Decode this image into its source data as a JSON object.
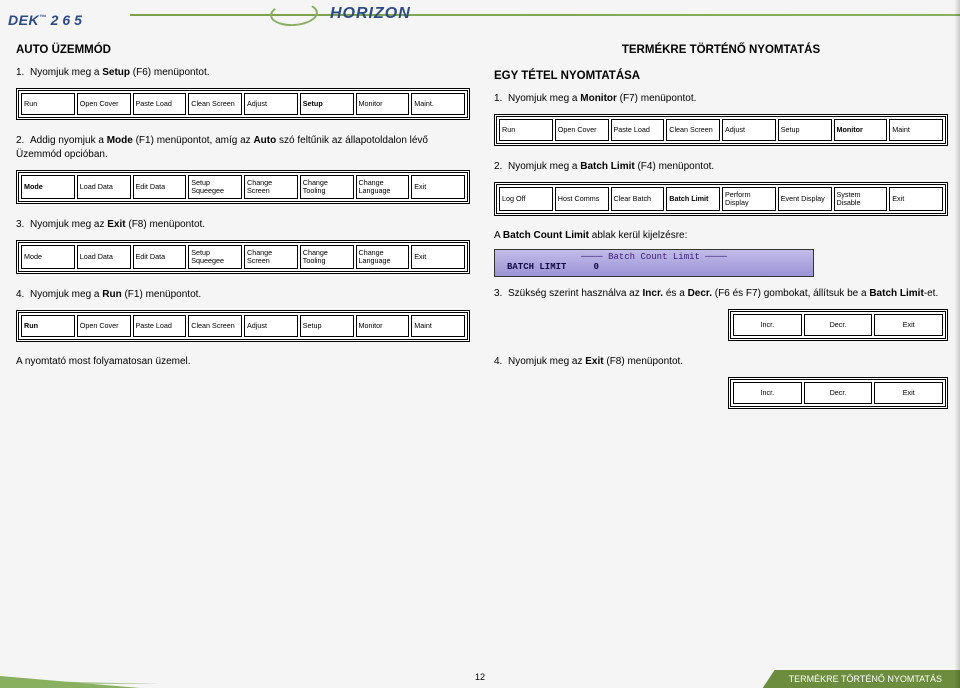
{
  "header": {
    "brand": "DEK",
    "model_number": "265",
    "brand_sub": "",
    "product_line": "HORIZON",
    "tm": "™"
  },
  "page_title": "TERMÉKRE TÖRTÉNŐ NYOMTATÁS",
  "left": {
    "title": "AUTO ÜZEMMÓD",
    "step1": {
      "num": "1.",
      "pre": "Nyomjuk meg a ",
      "b": "Setup",
      "post": " (F6) menüpontot."
    },
    "strip1": [
      "Run",
      "Open Cover",
      "Paste Load",
      "Clean Screen",
      "Adjust",
      "Setup",
      "Monitor",
      "Maint."
    ],
    "step2": {
      "num": "2.",
      "pre": "Addig nyomjuk a ",
      "b1": "Mode",
      "mid": " (F1) menüpontot, amíg az ",
      "b2": "Auto",
      "post": " szó feltűnik az állapotoldalon lévő Üzemmód opcióban."
    },
    "strip2": [
      "Mode",
      "Load Data",
      "Edit Data",
      "Setup Squeegee",
      "Change Screen",
      "Change Tooling",
      "Change Language",
      "Exit"
    ],
    "step3": {
      "num": "3.",
      "pre": "Nyomjuk meg az ",
      "b": "Exit",
      "post": " (F8) menüpontot."
    },
    "strip3": [
      "Mode",
      "Load Data",
      "Edit Data",
      "Setup Squeegee",
      "Change Screen",
      "Change Tooling",
      "Change Language",
      "Exit"
    ],
    "step4": {
      "num": "4.",
      "pre": "Nyomjuk meg a ",
      "b": "Run",
      "post": " (F1) menüpontot."
    },
    "strip4": [
      "Run",
      "Open Cover",
      "Paste Load",
      "Clean Screen",
      "Adjust",
      "Setup",
      "Monitor",
      "Maint"
    ],
    "note": "A nyomtató most folyamatosan üzemel."
  },
  "right": {
    "title": "EGY TÉTEL NYOMTATÁSA",
    "step1": {
      "num": "1.",
      "pre": "Nyomjuk meg a ",
      "b": "Monitor",
      "post": " (F7) menüpontot."
    },
    "strip1": [
      "Run",
      "Open Cover",
      "Paste Load",
      "Clean Screen",
      "Adjust",
      "Setup",
      "Monitor",
      "Maint"
    ],
    "step2": {
      "num": "2.",
      "pre": "Nyomjuk meg a ",
      "b": "Batch Limit",
      "post": " (F4) menüpontot."
    },
    "strip2": [
      "Log Off",
      "Host Comms",
      "Clear Batch",
      "Batch Limit",
      "Perform Display",
      "Event Display",
      "System Disable",
      "Exit"
    ],
    "batch_note_pre": "A ",
    "batch_note_b": "Batch Count Limit",
    "batch_note_post": " ablak kerül kijelzésre:",
    "batch_display": {
      "title": "Batch Count Limit",
      "label": "BATCH LIMIT",
      "value": "0"
    },
    "step3": {
      "num": "3.",
      "pre": "Szükség szerint használva az ",
      "b1": "Incr.",
      "mid1": " és a ",
      "b2": "Decr.",
      "mid2": " (F6 és F7) gombokat, állítsuk be a ",
      "b3": "Batch Limit",
      "post": "-et."
    },
    "strip3": [
      "Incr.",
      "Decr.",
      "Exit"
    ],
    "step4": {
      "num": "4.",
      "pre": "Nyomjuk meg az ",
      "b": "Exit",
      "post": " (F8) menüpontot."
    },
    "strip4": [
      "Incr.",
      "Decr.",
      "Exit"
    ]
  },
  "footer": {
    "page_number": "12",
    "tab_label": "TERMÉKRE TÖRTÉNŐ NYOMTATÁS"
  }
}
